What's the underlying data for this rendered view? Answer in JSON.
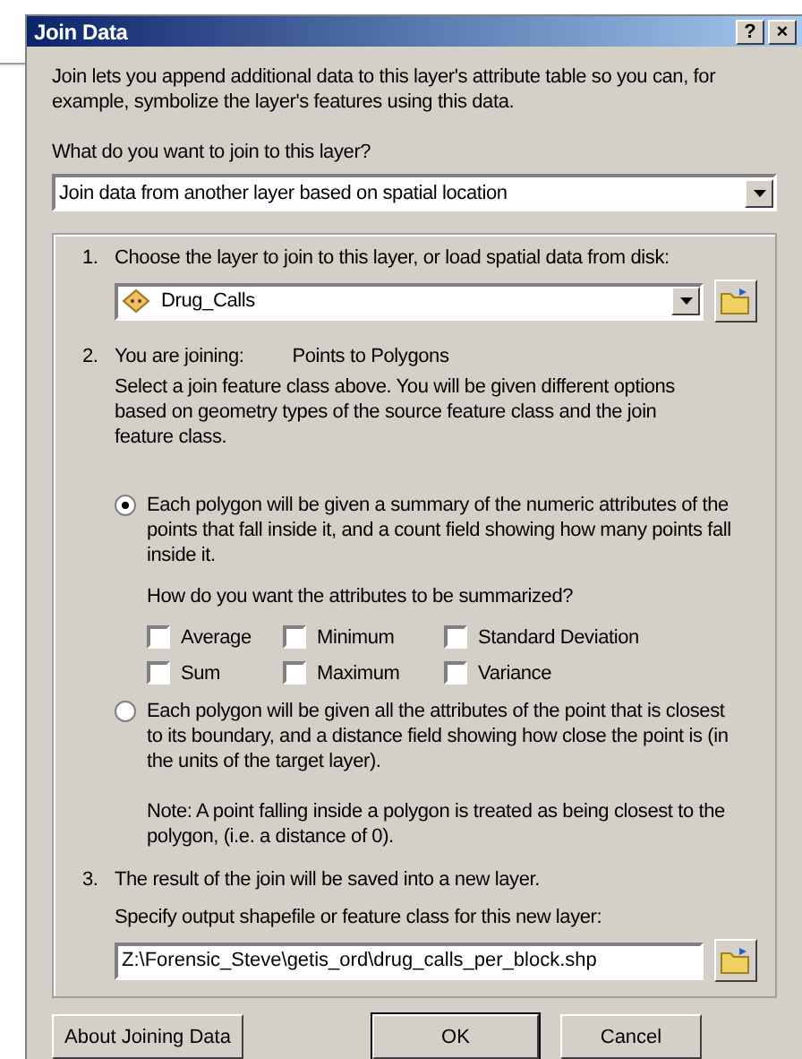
{
  "window": {
    "title": "Join Data",
    "help_button": "?",
    "close_button": "×"
  },
  "intro": "Join lets you append additional data to this layer's attribute table so you can, for example, symbolize the layer's features using this data.",
  "join_type": {
    "label": "What do you want to join to this layer?",
    "value": "Join data from another layer based on spatial location"
  },
  "step1": {
    "number": "1.",
    "label": "Choose the layer to join to this layer, or load spatial data from disk:",
    "layer": "Drug_Calls"
  },
  "step2": {
    "number": "2.",
    "label": "You are joining:",
    "joining": "Points to Polygons",
    "description": "Select a join feature class above.  You will be given different options based on geometry types of the source feature class and the join feature class."
  },
  "options": [
    {
      "text": "Each polygon will be given a summary of the numeric attributes of the points that fall inside it, and a count field showing how many points fall inside it.",
      "selected": true,
      "kind": "summary"
    },
    {
      "text": "Each polygon will be given all the attributes of the point that is closest to its boundary, and a distance field showing how close the point is (in the units of the target layer).",
      "selected": false,
      "kind": "closest",
      "note": "Note: A point falling inside a polygon is treated as being closest to the polygon, (i.e. a distance of 0)."
    }
  ],
  "summary": {
    "question": "How do you want the attributes to be summarized?",
    "stats": [
      {
        "label": "Average",
        "checked": false
      },
      {
        "label": "Minimum",
        "checked": false
      },
      {
        "label": "Standard Deviation",
        "checked": false
      },
      {
        "label": "Sum",
        "checked": false
      },
      {
        "label": "Maximum",
        "checked": false
      },
      {
        "label": "Variance",
        "checked": false
      }
    ]
  },
  "step3": {
    "number": "3.",
    "label": "The result of the join will be saved into a new layer.",
    "output_label": "Specify output shapefile or feature class for this new layer:",
    "output_path": "Z:\\Forensic_Steve\\getis_ord\\drug_calls_per_block.shp"
  },
  "buttons": [
    {
      "label": "About Joining Data",
      "kind": "help"
    },
    {
      "label": "OK",
      "kind": "ok"
    },
    {
      "label": "Cancel",
      "kind": "cancel"
    }
  ]
}
